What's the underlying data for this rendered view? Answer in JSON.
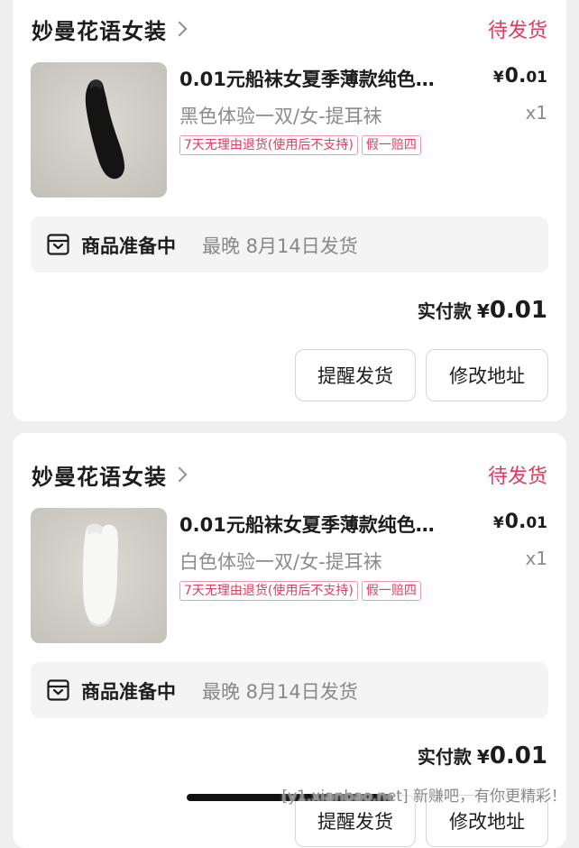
{
  "orders": [
    {
      "shop_name": "妙曼花语女装",
      "status": "待发货",
      "product": {
        "image": "black-sock-photo",
        "title": "0.01元船袜女夏季薄款纯色…",
        "price_currency": "¥",
        "price_int": "0.",
        "price_dec": "01",
        "spec": "黑色体验一双/女-提耳袜",
        "qty": "x1",
        "tags": [
          "7天无理由退货(使用后不支持)",
          "假一赔四"
        ]
      },
      "prep_label": "商品准备中",
      "prep_time": "最晚 8月14日发货",
      "paid_label": "实付款",
      "paid_currency": "¥",
      "paid_amount": "0.01",
      "buttons": {
        "remind": "提醒发货",
        "address": "修改地址"
      }
    },
    {
      "shop_name": "妙曼花语女装",
      "status": "待发货",
      "product": {
        "image": "white-sock-photo",
        "title": "0.01元船袜女夏季薄款纯色…",
        "price_currency": "¥",
        "price_int": "0.",
        "price_dec": "01",
        "spec": "白色体验一双/女-提耳袜",
        "qty": "x1",
        "tags": [
          "7天无理由退货(使用后不支持)",
          "假一赔四"
        ]
      },
      "prep_label": "商品准备中",
      "prep_time": "最晚 8月14日发货",
      "paid_label": "实付款",
      "paid_currency": "¥",
      "paid_amount": "0.01",
      "buttons": {
        "remind": "提醒发货",
        "address": "修改地址"
      }
    }
  ],
  "watermark": "[y1.xianbao.net] 新赚吧，有你更精彩！",
  "colors": {
    "status": "#e33b5d",
    "background": "#efefef",
    "card": "#ffffff"
  },
  "icons": {
    "chevron": "chevron-right-icon",
    "package": "package-box-icon"
  }
}
